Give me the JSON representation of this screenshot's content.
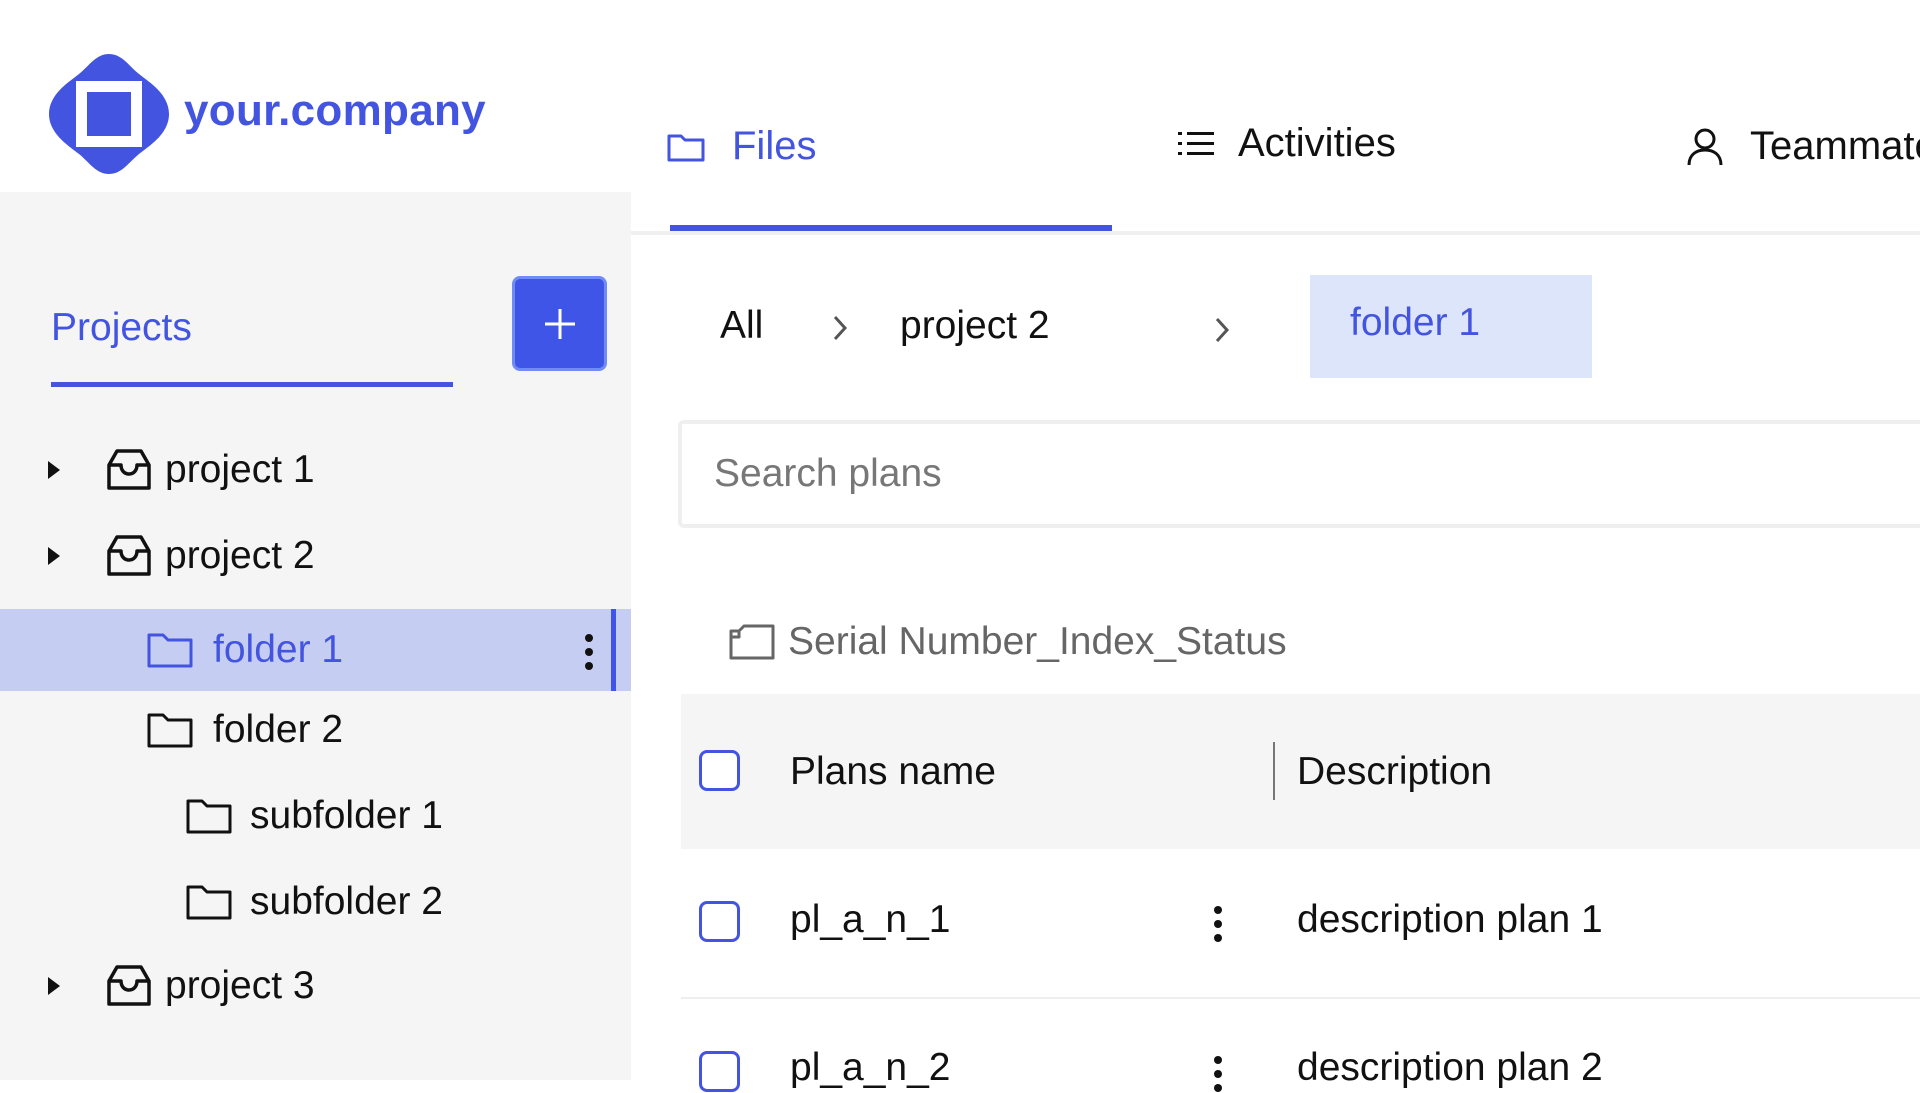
{
  "brand": {
    "name": "your.company",
    "color": "#4355e0"
  },
  "tabs": [
    {
      "label": "Files",
      "icon": "folder-icon",
      "active": true
    },
    {
      "label": "Activities",
      "icon": "list-icon",
      "active": false
    },
    {
      "label": "Teammates",
      "icon": "user-icon",
      "active": false
    }
  ],
  "sidebar": {
    "title": "Projects",
    "add_button_icon": "plus-icon",
    "tree": [
      {
        "label": "project 1",
        "icon": "inbox-icon",
        "expandable": true
      },
      {
        "label": "project 2",
        "icon": "inbox-icon",
        "expandable": true
      },
      {
        "label": "folder 1",
        "icon": "folder-icon",
        "selected": true
      },
      {
        "label": "folder 2",
        "icon": "folder-icon"
      },
      {
        "label": "subfolder 1",
        "icon": "folder-icon"
      },
      {
        "label": "subfolder 2",
        "icon": "folder-icon"
      },
      {
        "label": "project 3",
        "icon": "inbox-icon",
        "expandable": true
      }
    ]
  },
  "breadcrumb": [
    "All",
    "project 2",
    "folder 1"
  ],
  "search": {
    "placeholder": "Search plans",
    "value": ""
  },
  "naming_hint": "Serial Number_Index_Status",
  "table": {
    "columns": [
      "Plans name",
      "Description"
    ],
    "rows": [
      {
        "name": "pl_a_n_1",
        "description": "description plan 1"
      },
      {
        "name": "pl_a_n_2",
        "description": "description plan 2"
      }
    ]
  },
  "colors": {
    "accent": "#4355e0",
    "sidebar_bg": "#f5f5f5",
    "selected_row_bg": "#c5cdf2",
    "active_crumb_bg": "#dde5fb"
  }
}
